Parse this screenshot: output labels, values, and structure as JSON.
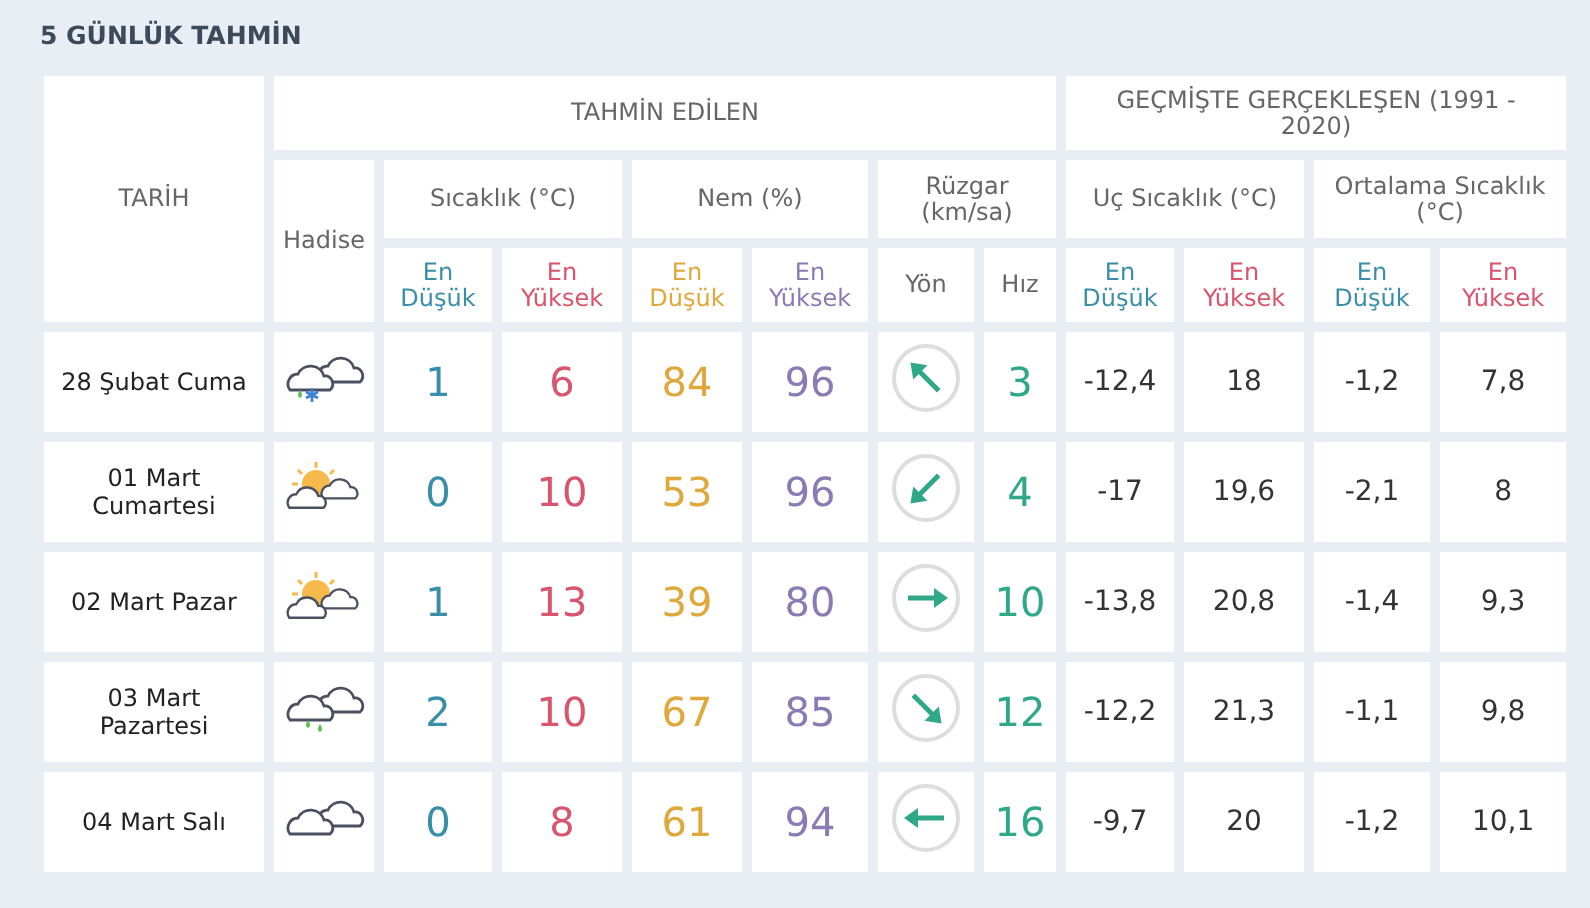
{
  "title": "5 GÜNLÜK TAHMİN",
  "headers": {
    "date": "TARİH",
    "forecast": "TAHMİN EDİLEN",
    "past": "GEÇMİŞTE GERÇEKLEŞEN (1991 - 2020)",
    "event": "Hadise",
    "temp": "Sıcaklık (°C)",
    "humidity": "Nem (%)",
    "wind": "Rüzgar (km/sa)",
    "extreme": "Uç Sıcaklık (°C)",
    "average": "Ortalama Sıcaklık (°C)",
    "direction": "Yön",
    "speed": "Hız",
    "sub": [
      {
        "text": "En Düşük",
        "kind": "low-temp"
      },
      {
        "text": "En Yüksek",
        "kind": "high-temp"
      },
      {
        "text": "En Düşük",
        "kind": "low-hum"
      },
      {
        "text": "En Yüksek",
        "kind": "high-hum"
      }
    ],
    "past_sub": [
      {
        "text": "En Düşük",
        "kind": "low-temp"
      },
      {
        "text": "En Yüksek",
        "kind": "high-temp"
      },
      {
        "text": "En Düşük",
        "kind": "low-temp"
      },
      {
        "text": "En Yüksek",
        "kind": "high-temp"
      }
    ]
  },
  "rows": [
    {
      "date": "28 Şubat Cuma",
      "weather": {
        "kind": "sleet"
      },
      "min": "1",
      "max": "6",
      "hum_min": "84",
      "hum_max": "96",
      "wind_direction": {
        "kind": "nw"
      },
      "speed": "3",
      "ext_min": "-12,4",
      "ext_max": "18",
      "avg_min": "-1,2",
      "avg_max": "7,8"
    },
    {
      "date": "01 Mart Cumartesi",
      "weather": {
        "kind": "partly-cloudy"
      },
      "min": "0",
      "max": "10",
      "hum_min": "53",
      "hum_max": "96",
      "wind_direction": {
        "kind": "sw"
      },
      "speed": "4",
      "ext_min": "-17",
      "ext_max": "19,6",
      "avg_min": "-2,1",
      "avg_max": "8"
    },
    {
      "date": "02 Mart Pazar",
      "weather": {
        "kind": "partly-cloudy"
      },
      "min": "1",
      "max": "13",
      "hum_min": "39",
      "hum_max": "80",
      "wind_direction": {
        "kind": "e"
      },
      "speed": "10",
      "ext_min": "-13,8",
      "ext_max": "20,8",
      "avg_min": "-1,4",
      "avg_max": "9,3"
    },
    {
      "date": "03 Mart Pazartesi",
      "weather": {
        "kind": "rain"
      },
      "min": "2",
      "max": "10",
      "hum_min": "67",
      "hum_max": "85",
      "wind_direction": {
        "kind": "se"
      },
      "speed": "12",
      "ext_min": "-12,2",
      "ext_max": "21,3",
      "avg_min": "-1,1",
      "avg_max": "9,8"
    },
    {
      "date": "04 Mart Salı",
      "weather": {
        "kind": "cloudy"
      },
      "min": "0",
      "max": "8",
      "hum_min": "61",
      "hum_max": "94",
      "wind_direction": {
        "kind": "w"
      },
      "speed": "16",
      "ext_min": "-9,7",
      "ext_max": "20",
      "avg_min": "-1,2",
      "avg_max": "10,1"
    }
  ]
}
